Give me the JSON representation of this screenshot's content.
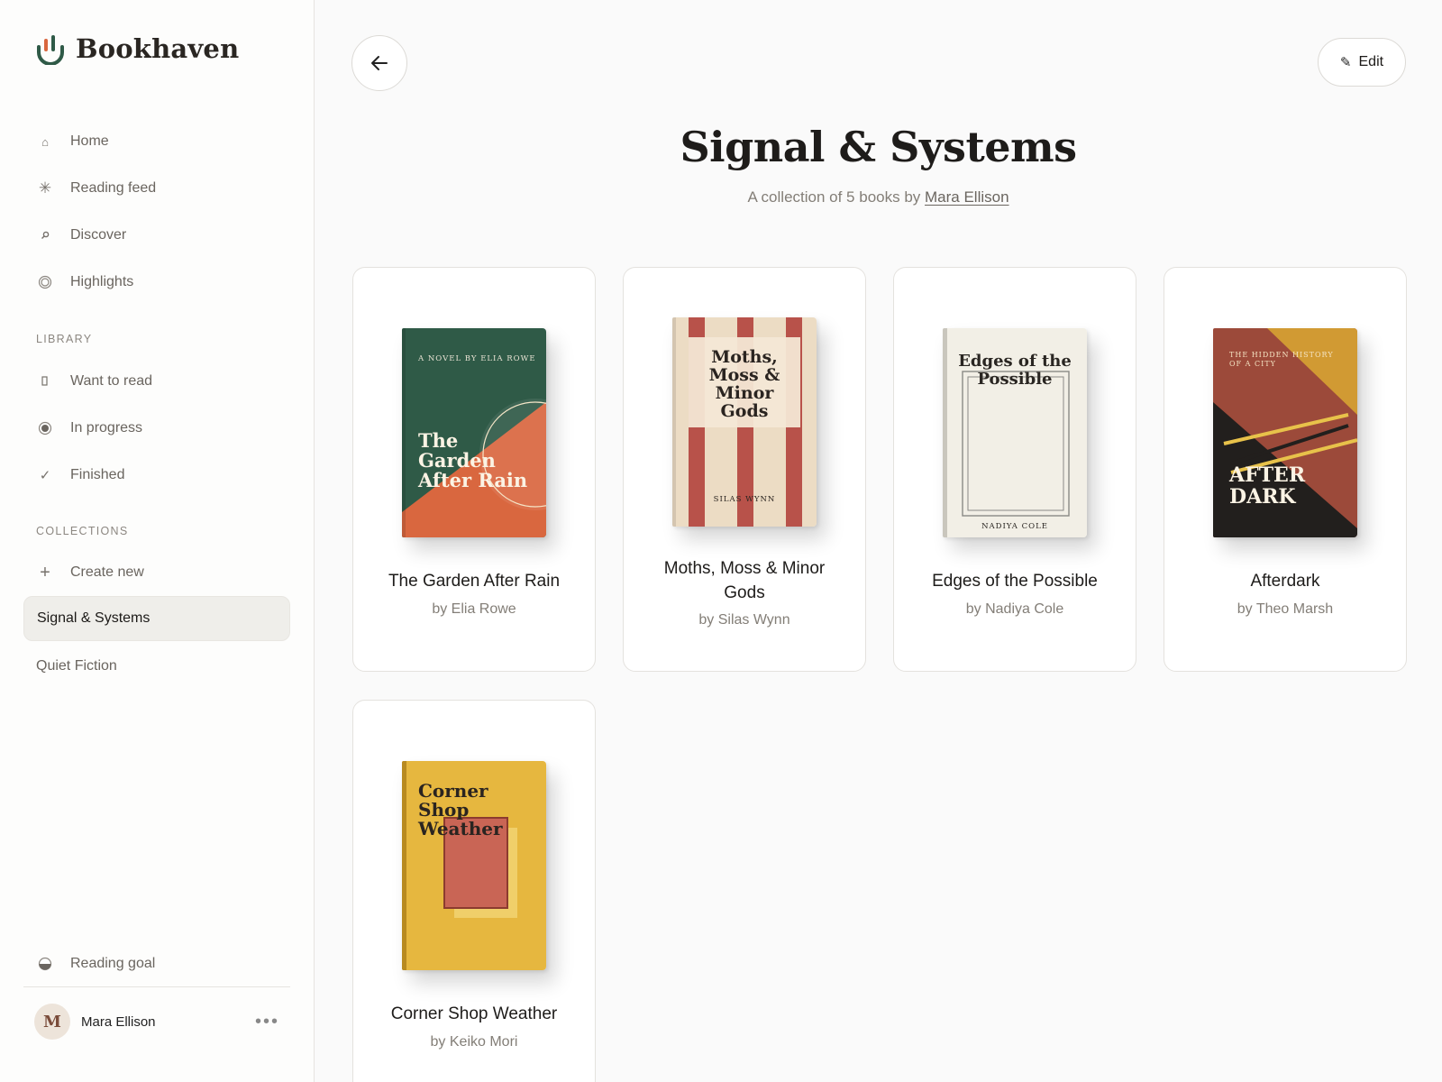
{
  "app": {
    "name": "Bookhaven"
  },
  "nav": {
    "items": [
      {
        "label": "Home",
        "icon": "home-icon"
      },
      {
        "label": "Reading feed",
        "icon": "sparkle-icon"
      },
      {
        "label": "Discover",
        "icon": "search-icon"
      },
      {
        "label": "Highlights",
        "icon": "highlight-icon"
      }
    ]
  },
  "library": {
    "heading": "LIBRARY",
    "items": [
      {
        "label": "Want to read",
        "icon": "bookmark-icon"
      },
      {
        "label": "In progress",
        "icon": "progress-icon"
      },
      {
        "label": "Finished",
        "icon": "check-icon"
      }
    ]
  },
  "collections": {
    "heading": "COLLECTIONS",
    "create_label": "Create new",
    "items": [
      {
        "label": "Signal & Systems",
        "active": true
      },
      {
        "label": "Quiet Fiction",
        "active": false
      }
    ]
  },
  "footer": {
    "goal_label": "Reading goal",
    "user": {
      "initial": "M",
      "name": "Mara Ellison",
      "more": "•••"
    }
  },
  "header": {
    "edit_label": "Edit"
  },
  "collection": {
    "title": "Signal & Systems",
    "subtitle_prefix": "A collection of 5 books by",
    "author": "Mara Ellison"
  },
  "books": [
    {
      "title": "The Garden After Rain",
      "author": "by Elia Rowe",
      "cover": {
        "top_text": "A NOVEL BY ELIA ROWE",
        "lines": [
          "The",
          "Garden",
          "After Rain"
        ],
        "colors": {
          "base": "#2f5a47",
          "accent": "#d9673f"
        }
      }
    },
    {
      "title": "Moths, Moss & Minor Gods",
      "author": "by Silas Wynn",
      "cover": {
        "lines": [
          "Moths,",
          "Moss &",
          "Minor",
          "Gods"
        ],
        "bottom_text": "SILAS WYNN",
        "colors": {
          "base": "#ecdcc4",
          "accent": "#b8524a"
        }
      }
    },
    {
      "title": "Edges of the Possible",
      "author": "by Nadiya Cole",
      "cover": {
        "lines": [
          "Edges of the",
          "Possible"
        ],
        "bottom_text": "NADIYA COLE",
        "colors": {
          "base": "#f2efe6",
          "accent": "#8a8a86"
        }
      }
    },
    {
      "title": "Afterdark",
      "author": "by Theo Marsh",
      "cover": {
        "top_lines": [
          "THE HIDDEN HISTORY",
          "OF A CITY"
        ],
        "lines": [
          "AFTER",
          "DARK"
        ],
        "colors": {
          "base": "#9c4a3a",
          "accent": "#d19a33",
          "dark": "#221f1d"
        }
      }
    },
    {
      "title": "Corner Shop Weather",
      "author": "by Keiko Mori",
      "cover": {
        "lines": [
          "Corner",
          "Shop",
          "Weather"
        ],
        "colors": {
          "base": "#e6b73f",
          "accent": "#c96555"
        }
      }
    }
  ]
}
